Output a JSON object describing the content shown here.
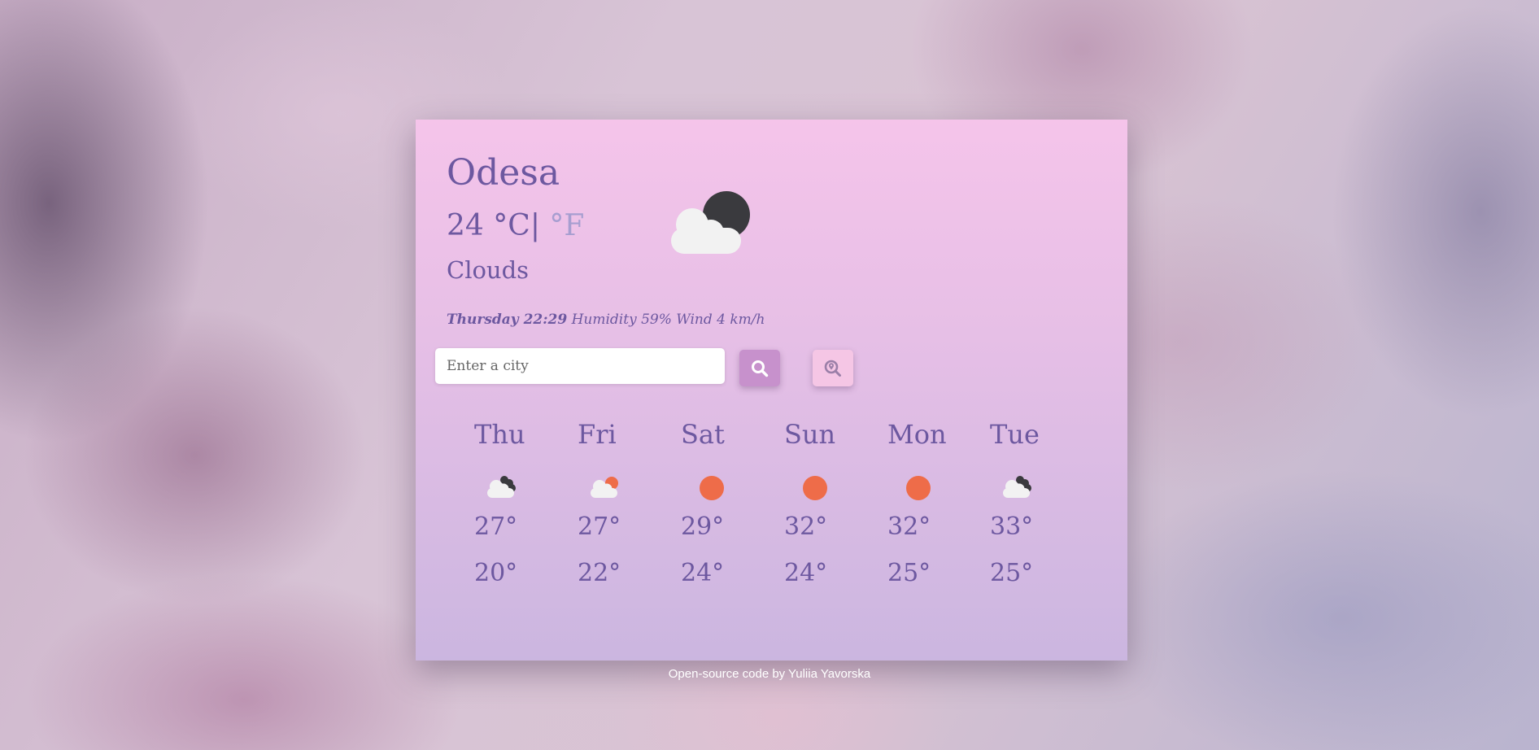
{
  "current": {
    "city": "Odesa",
    "temperature": "24",
    "unit_celsius": " °C",
    "unit_separator": "|",
    "unit_fahrenheit": " °F",
    "description": "Clouds",
    "icon": "cloud-with-moon-icon",
    "day_time": "Thursday 22:29",
    "humidity": "Humidity 59%",
    "wind": "Wind 4 km/h"
  },
  "search": {
    "placeholder": "Enter a city",
    "search_icon": "search-icon",
    "location_icon": "location-search-icon"
  },
  "forecast": [
    {
      "day": "Thu",
      "icon": "cloud-with-moon-icon",
      "max": "27°",
      "min": "20°"
    },
    {
      "day": "Fri",
      "icon": "cloud-with-sun-icon",
      "max": "27°",
      "min": "22°"
    },
    {
      "day": "Sat",
      "icon": "sun-icon",
      "max": "29°",
      "min": "24°"
    },
    {
      "day": "Sun",
      "icon": "sun-icon",
      "max": "32°",
      "min": "24°"
    },
    {
      "day": "Mon",
      "icon": "sun-icon",
      "max": "32°",
      "min": "25°"
    },
    {
      "day": "Tue",
      "icon": "cloud-with-moon-icon",
      "max": "33°",
      "min": "25°"
    }
  ],
  "footer": {
    "text": "Open-source code by Yuliia Yavorska"
  },
  "colors": {
    "text": "#6d58a0",
    "sun": "#ee6c49",
    "moon": "#3a3a3e",
    "search_button": "#c791cc",
    "location_button": "#f5c6e5"
  }
}
